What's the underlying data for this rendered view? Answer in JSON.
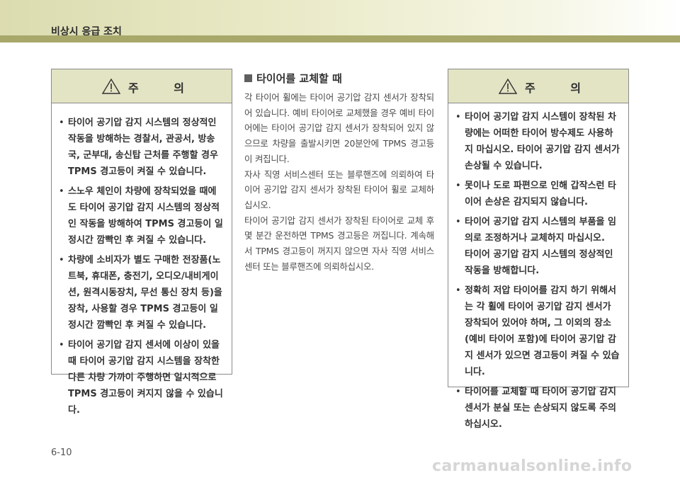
{
  "header": {
    "title": "비상시 응급 조치"
  },
  "left_box": {
    "title": "주 의",
    "items": [
      "타이어 공기압 감지 시스템의 정상적인 작동을 방해하는 경찰서, 관공서, 방송국, 군부대, 송신탑 근처를 주행할 경우 TPMS 경고등이 켜질 수 있습니다.",
      "스노우 체인이 차량에 장착되었을 때에도 타이어 공기압 감지 시스템의 정상적인 작동을 방해하여 TPMS 경고등이 일정시간 깜빡인 후 켜질 수 있습니다.",
      "차량에 소비자가 별도 구매한 전장품(노트북, 휴대폰, 충전기, 오디오/내비게이션, 원격시동장치, 무선 통신 장치 등)을 장착, 사용할 경우 TPMS 경고등이 일정시간 깜빡인 후 켜질 수 있습니다.",
      "타이어 공기압 감지 센서에 이상이 있을 때 타이어 공기압 감지 시스템을 장착한 다른 차량 가까이 주행하면 일시적으로 TPMS 경고등이 켜지지 않을 수 있습니다."
    ]
  },
  "center": {
    "section_title": "타이어를 교체할 때",
    "paragraphs": [
      "각 타이어 휠에는 타이어 공기압 감지 센서가 장착되어 있습니다. 예비 타이어로 교체했을 경우 예비 타이어에는 타이어 공기압 감지 센서가 장착되어 있지 않으므로 차량을 출발시키면 20분안에 TPMS 경고등이 켜집니다.",
      "자사 직영 서비스센터 또는 블루핸즈에 의뢰하여 타이어 공기압 감지 센서가 장착된 타이어 휠로 교체하십시오.",
      "타이어 공기압 감지 센서가 장착된 타이어로 교체 후 몇 분간 운전하면 TPMS 경고등은 꺼집니다. 계속해서 TPMS 경고등이 꺼지지 않으면 자사 직영 서비스센터 또는 블루핸즈에 의뢰하십시오."
    ]
  },
  "right_box": {
    "title": "주 의",
    "items": [
      {
        "text": "타이어 공기압 감지 시스템이 장착된 차량에는 어떠한 타이어 방수제도 사용하지 마십시오. 타이어 공기압 감지 센서가 손상될 수 있습니다.",
        "extra": ""
      },
      {
        "text": "못이나 도로 파편으로 인해 갑작스런 타이어 손상은 감지되지 않습니다.",
        "extra": ""
      },
      {
        "text": "타이어 공기압 감지 시스템의 부품을 임의로 조정하거나 교체하지 마십시오.",
        "extra": "타이어 공기압 감지 시스템의 정상적인 작동을 방해합니다."
      },
      {
        "text": "정확히 저압 타이어를 감지 하기 위해서는 각 휠에 타이어 공기압 감지 센서가 장착되어 있어야 하며, 그 이외의 장소(예비 타이어 포함)에 타이어 공기압 감지 센서가 있으면 경고등이 켜질 수 있습니다.",
        "extra": ""
      },
      {
        "text": "타이어를 교체할 때 타이어 공기압 감지 센서가 분실 또는 손상되지 않도록 주의하십시오.",
        "extra": ""
      }
    ]
  },
  "footer": {
    "page_number": "6-10",
    "watermark": "carmanualsonline.info"
  },
  "colors": {
    "header_band": "#dcdcb0",
    "header_rule": "#a7a86a",
    "box_head": "#e3e4c4"
  }
}
